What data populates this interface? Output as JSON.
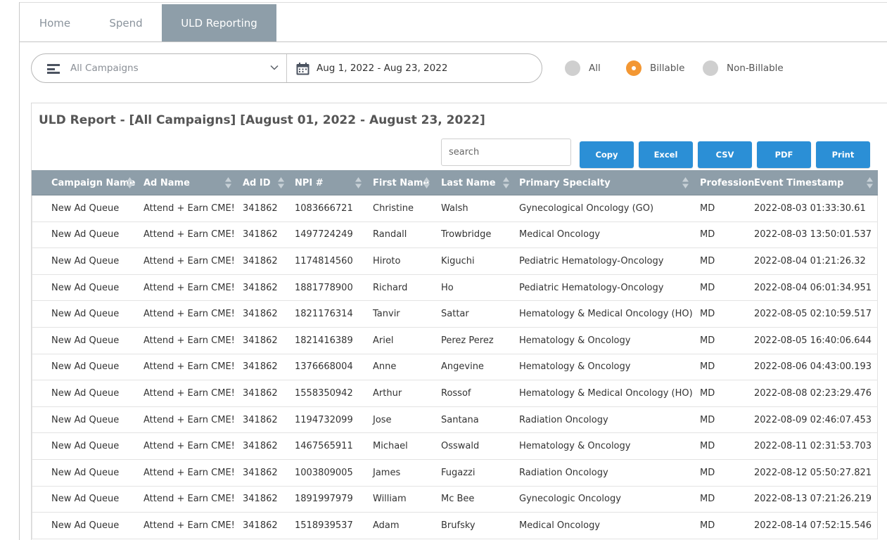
{
  "tabs": [
    {
      "label": "Home"
    },
    {
      "label": "Spend"
    },
    {
      "label": "ULD Reporting"
    }
  ],
  "filters": {
    "campaign_select": "All Campaigns",
    "date_range": "Aug 1, 2022 - Aug 23, 2022",
    "radios": [
      {
        "label": "All",
        "checked": false
      },
      {
        "label": "Billable",
        "checked": true
      },
      {
        "label": "Non-Billable",
        "checked": false
      }
    ]
  },
  "report": {
    "title": "ULD Report - [All Campaigns] [August 01, 2022 - August 23, 2022]",
    "search_placeholder": "search",
    "buttons": [
      "Copy",
      "Excel",
      "CSV",
      "PDF",
      "Print"
    ]
  },
  "table": {
    "columns": [
      "Campaign Name",
      "Ad Name",
      "Ad ID",
      "NPI #",
      "First Name",
      "Last Name",
      "Primary Specialty",
      "Profession",
      "Event Timestamp"
    ],
    "rows": [
      [
        "New Ad Queue",
        "Attend + Earn CME!",
        "341862",
        "1083666721",
        "Christine",
        "Walsh",
        "Gynecological Oncology (GO)",
        "MD",
        "2022-08-03 01:33:30.61"
      ],
      [
        "New Ad Queue",
        "Attend + Earn CME!",
        "341862",
        "1497724249",
        "Randall",
        "Trowbridge",
        "Medical Oncology",
        "MD",
        "2022-08-03 13:50:01.537"
      ],
      [
        "New Ad Queue",
        "Attend + Earn CME!",
        "341862",
        "1174814560",
        "Hiroto",
        "Kiguchi",
        "Pediatric Hematology-Oncology",
        "MD",
        "2022-08-04 01:21:26.32"
      ],
      [
        "New Ad Queue",
        "Attend + Earn CME!",
        "341862",
        "1881778900",
        "Richard",
        "Ho",
        "Pediatric Hematology-Oncology",
        "MD",
        "2022-08-04 06:01:34.951"
      ],
      [
        "New Ad Queue",
        "Attend + Earn CME!",
        "341862",
        "1821176314",
        "Tanvir",
        "Sattar",
        "Hematology & Medical Oncology (HO)",
        "MD",
        "2022-08-05 02:10:59.517"
      ],
      [
        "New Ad Queue",
        "Attend + Earn CME!",
        "341862",
        "1821416389",
        "Ariel",
        "Perez Perez",
        "Hematology & Oncology",
        "MD",
        "2022-08-05 16:40:06.644"
      ],
      [
        "New Ad Queue",
        "Attend + Earn CME!",
        "341862",
        "1376668004",
        "Anne",
        "Angevine",
        "Hematology & Oncology",
        "MD",
        "2022-08-06 04:43:00.193"
      ],
      [
        "New Ad Queue",
        "Attend + Earn CME!",
        "341862",
        "1558350942",
        "Arthur",
        "Rossof",
        "Hematology & Medical Oncology (HO)",
        "MD",
        "2022-08-08 02:23:29.476"
      ],
      [
        "New Ad Queue",
        "Attend + Earn CME!",
        "341862",
        "1194732099",
        "Jose",
        "Santana",
        "Radiation Oncology",
        "MD",
        "2022-08-09 02:46:07.453"
      ],
      [
        "New Ad Queue",
        "Attend + Earn CME!",
        "341862",
        "1467565911",
        "Michael",
        "Osswald",
        "Hematology & Oncology",
        "MD",
        "2022-08-11 02:31:53.703"
      ],
      [
        "New Ad Queue",
        "Attend + Earn CME!",
        "341862",
        "1003809005",
        "James",
        "Fugazzi",
        "Radiation Oncology",
        "MD",
        "2022-08-12 05:50:27.821"
      ],
      [
        "New Ad Queue",
        "Attend + Earn CME!",
        "341862",
        "1891997979",
        "William",
        "Mc Bee",
        "Gynecologic Oncology",
        "MD",
        "2022-08-13 07:21:26.219"
      ],
      [
        "New Ad Queue",
        "Attend + Earn CME!",
        "341862",
        "1518939537",
        "Adam",
        "Brufsky",
        "Medical Oncology",
        "MD",
        "2022-08-14 07:52:15.546"
      ]
    ]
  },
  "colors": {
    "header_bg": "#8e9ea9",
    "button_blue": "#2b8fd6",
    "radio_selected": "#f39733",
    "radio_unselected": "#cfcfcf"
  }
}
